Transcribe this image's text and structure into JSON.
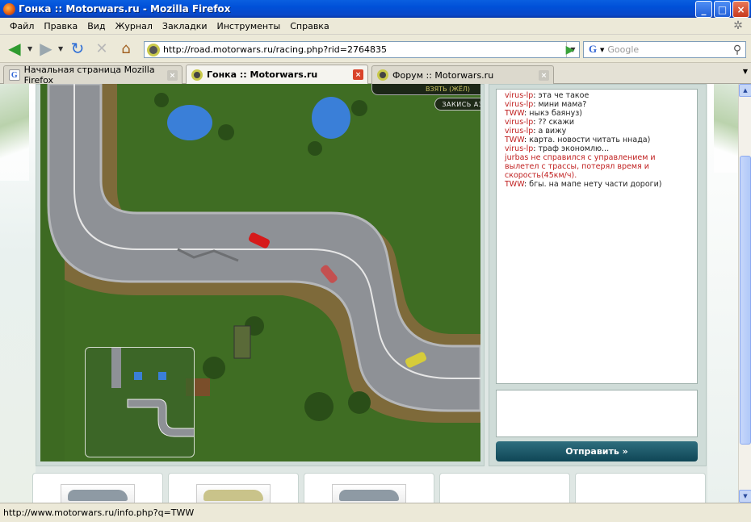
{
  "window": {
    "title": "Гонка :: Motorwars.ru - Mozilla Firefox",
    "buttons": {
      "minimize": "_",
      "maximize": "□",
      "close": "×"
    }
  },
  "menu": [
    "Файл",
    "Правка",
    "Вид",
    "Журнал",
    "Закладки",
    "Инструменты",
    "Справка"
  ],
  "navigation": {
    "url": "http://road.motorwars.ru/racing.php?rid=2764835",
    "search_engine_icon": "G",
    "search_placeholder": "Google"
  },
  "tabs": [
    {
      "label": "Начальная страница Mozilla Firefox",
      "favicon": "google-icon",
      "active": false
    },
    {
      "label": "Гонка :: Motorwars.ru",
      "favicon": "motorwars-icon",
      "active": true
    },
    {
      "label": "Форум :: Motorwars.ru",
      "favicon": "motorwars-icon",
      "active": false
    }
  ],
  "game": {
    "top_button": "ВЗЯТЬ (ЖЁЛ)",
    "nitro_button": "ЗАКИСЬ АЗОТА"
  },
  "chat": {
    "messages": [
      {
        "nick": "virus-lp",
        "text": "эта че такое"
      },
      {
        "nick": "virus-lp",
        "text": "мини мама?"
      },
      {
        "nick": "TWW",
        "text": "ныкэ баянуз)"
      },
      {
        "nick": "virus-lp",
        "text": "?? скажи"
      },
      {
        "nick": "virus-lp",
        "text": "а вижу"
      },
      {
        "nick": "TWW",
        "text": "карта. новости читать ннада)"
      },
      {
        "nick": "virus-lp",
        "text": "траф экономлю..."
      },
      {
        "nick": "",
        "text": "jurbas не справился с управлением и вылетел с трассы, потерял время и скорость(45км/ч).",
        "system": true
      },
      {
        "nick": "TWW",
        "text": "бгы. на мапе нету части дороги)"
      }
    ],
    "send_button": "Отправить »"
  },
  "status": "http://www.motorwars.ru/info.php?q=TWW",
  "colors": {
    "titlebar": "#0a50d8",
    "chat_nick": "#c02020",
    "send_button": "#1a5666",
    "grass": "#3f6d23",
    "road": "#8e9196"
  }
}
